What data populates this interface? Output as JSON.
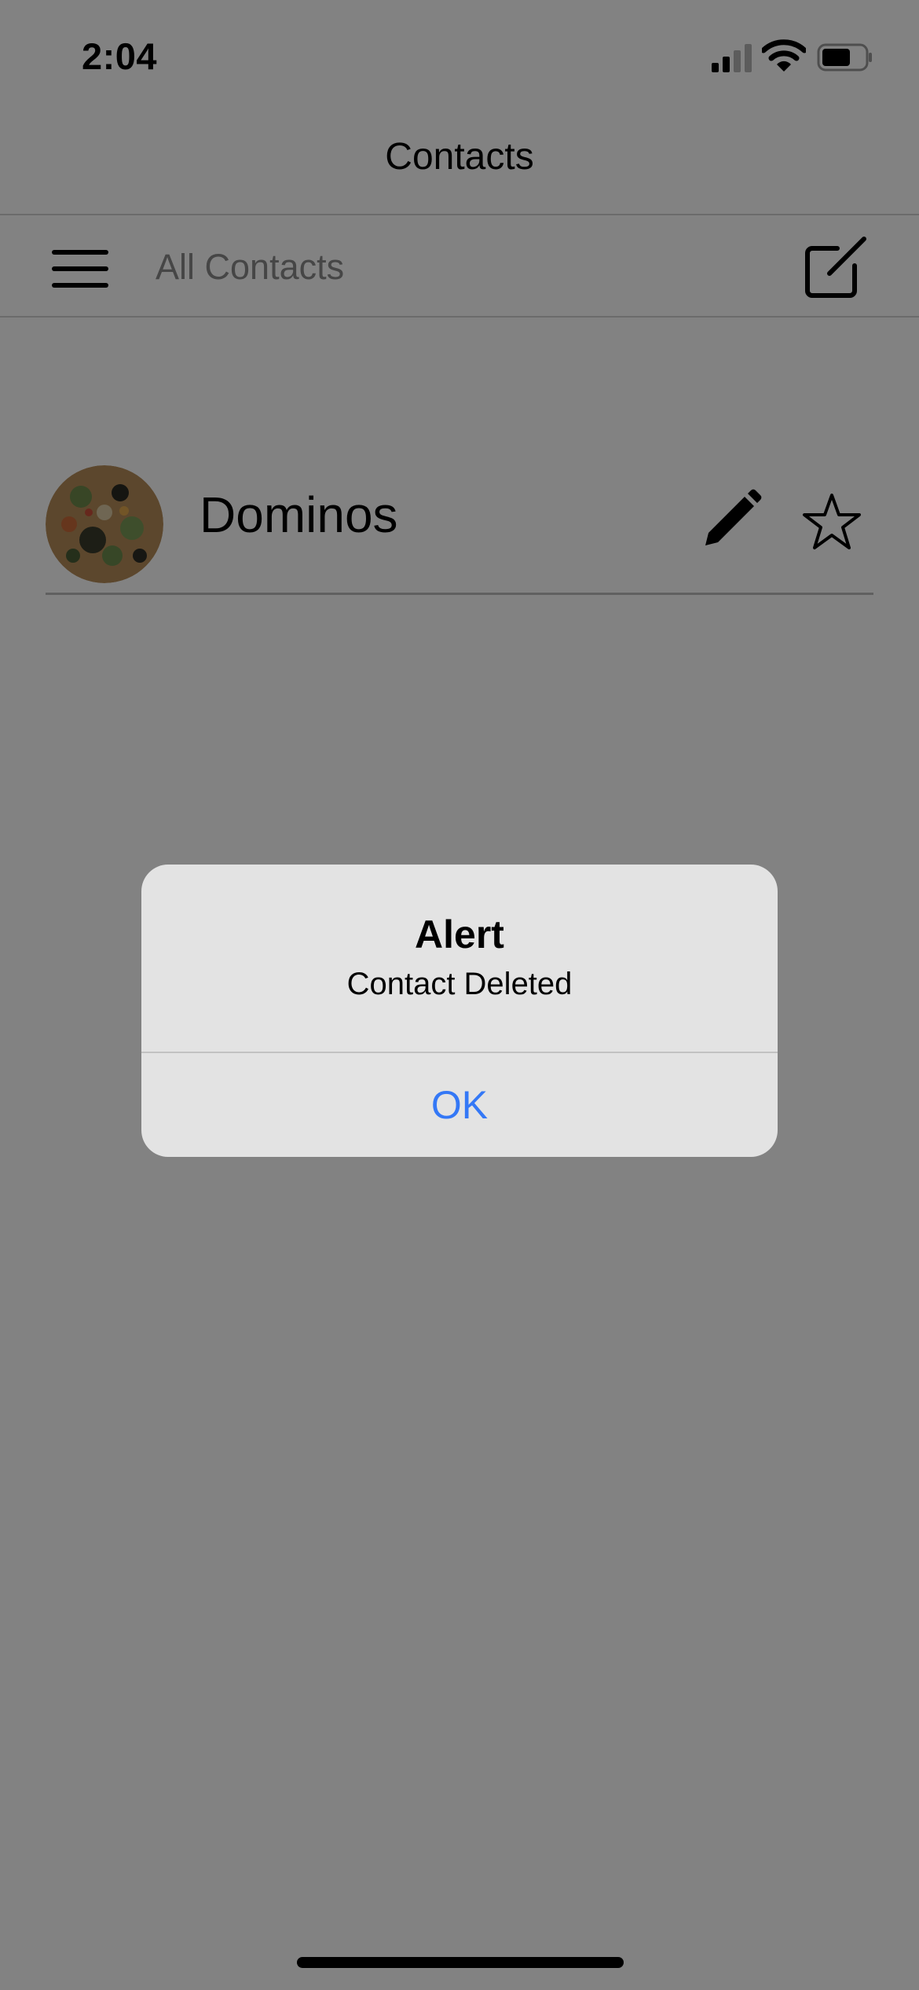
{
  "status_bar": {
    "time": "2:04"
  },
  "nav": {
    "title": "Contacts"
  },
  "toolbar": {
    "title": "All Contacts",
    "menu_icon": "hamburger-menu-icon",
    "compose_icon": "compose-icon"
  },
  "contacts": [
    {
      "name": "Dominos",
      "avatar": "pizza-photo",
      "edit_icon": "pencil-icon",
      "favorite_icon": "star-outline-icon"
    }
  ],
  "alert": {
    "title": "Alert",
    "message": "Contact Deleted",
    "button_label": "OK"
  },
  "colors": {
    "accent": "#3478f6",
    "overlay": "rgba(0,0,0,0.49)",
    "alert_bg": "#e3e3e3"
  }
}
